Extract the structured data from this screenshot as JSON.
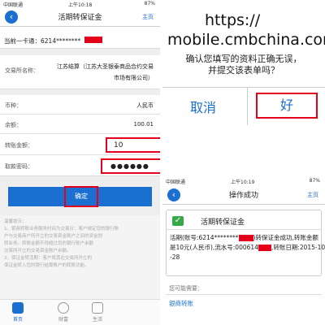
{
  "left": {
    "status": {
      "carrier": "中国联通",
      "time": "上午10:18",
      "battery": "87%"
    },
    "header": {
      "title": "活期转保证金",
      "home": "主页"
    },
    "card_label": "当前一卡通：6214********",
    "exchange": {
      "label": "交易所名称：",
      "value_line1": "江苏结算（江苏大圣银泰商品合约交易",
      "value_line2": "市场有限公司）"
    },
    "currency": {
      "label": "币种：",
      "value": "人民币"
    },
    "balance": {
      "label": "余额：",
      "value": "100.01"
    },
    "amount": {
      "label": "转账金额：",
      "value": "10"
    },
    "password": {
      "label": "取款密码：",
      "value": "●●●●●●"
    },
    "confirm_button": "确定",
    "notes": [
      "温馨提示：",
      "1、银商转账业务服务时间为交易日：客户绑定您的银行账",
      "户与交易商户所开立的交易资金账户之间的资金划",
      "转业务。转账金额不得超过您的银行账户余额",
      "交易所开立的交易资金账户余额。",
      "2、保证金转活期：客户将其在交易所开立的",
      "保证金转入您的银行结算账户的转账功能。"
    ],
    "tabs": [
      {
        "label": "首页"
      },
      {
        "label": "财富"
      },
      {
        "label": "生活"
      }
    ]
  },
  "top_right": {
    "url_line1": "https://",
    "url_line2": "mobile.cmbchina.com",
    "message_line1": "确认您填写的资料正确无误，",
    "message_line2": "并提交该表单吗？",
    "cancel": "取消",
    "ok": "好"
  },
  "bottom_right": {
    "status": {
      "carrier": "中国联通",
      "time": "上午10:19",
      "battery": "87%"
    },
    "header": {
      "title": "操作成功",
      "home": "主页"
    },
    "success_title": "活期转保证金",
    "detail_line1": "活期(账号:6214********",
    "detail_line1b": ")转保证金成功,转账金额",
    "detail_line2": "是10元(人民币),流水号:000614",
    "detail_line2b": ",转账日期:2015-10",
    "detail_line3": "-28",
    "section_label": "您可能需要：",
    "link": "银商转账"
  },
  "colors": {
    "accent": "#1a6fd0",
    "highlight": "#e4001b",
    "success": "#38a94b"
  }
}
